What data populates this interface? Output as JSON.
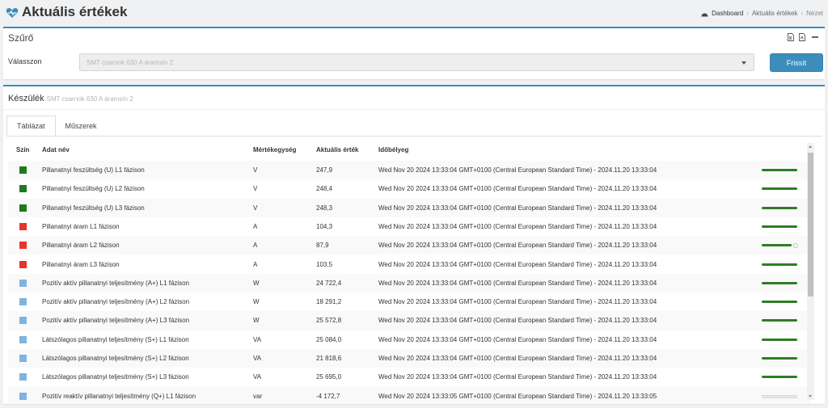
{
  "page": {
    "title": "Aktuális értékek"
  },
  "breadcrumb": {
    "items": [
      "Dashboard",
      "Aktuális értékek",
      "Nézet"
    ]
  },
  "filter": {
    "title": "Szűrő",
    "select_label": "Válasszon",
    "select_value": "SMT csarnok 630 A áramsín 2",
    "button_label": "Frissít"
  },
  "device": {
    "title": "Készülék",
    "subtitle": "SMT csarnok 630 A áramsín 2"
  },
  "tabs": [
    {
      "label": "Táblázat",
      "active": true
    },
    {
      "label": "Műszerek",
      "active": false
    }
  ],
  "table": {
    "headers": {
      "color": "Szín",
      "name": "Adat név",
      "unit": "Mértékegység",
      "value": "Aktuális érték",
      "timestamp": "Időbélyeg"
    },
    "rows": [
      {
        "color": "#1f7a1f",
        "name": "Pillanatnyi feszültség (U) L1 fázison",
        "unit": "V",
        "value": "247,9",
        "timestamp": "Wed Nov 20 2024 13:33:04 GMT+0100 (Central European Standard Time) - 2024.11.20 13:33:04",
        "level": 1.0
      },
      {
        "color": "#1f7a1f",
        "name": "Pillanatnyi feszültség (U) L2 fázison",
        "unit": "V",
        "value": "248,4",
        "timestamp": "Wed Nov 20 2024 13:33:04 GMT+0100 (Central European Standard Time) - 2024.11.20 13:33:04",
        "level": 1.0
      },
      {
        "color": "#1f7a1f",
        "name": "Pillanatnyi feszültség (U) L3 fázison",
        "unit": "V",
        "value": "248,3",
        "timestamp": "Wed Nov 20 2024 13:33:04 GMT+0100 (Central European Standard Time) - 2024.11.20 13:33:04",
        "level": 1.0
      },
      {
        "color": "#e8342a",
        "name": "Pillanatnyi áram L1 fázison",
        "unit": "A",
        "value": "104,3",
        "timestamp": "Wed Nov 20 2024 13:33:04 GMT+0100 (Central European Standard Time) - 2024.11.20 13:33:04",
        "level": 1.0
      },
      {
        "color": "#e8342a",
        "name": "Pillanatnyi áram L2 fázison",
        "unit": "A",
        "value": "87,9",
        "timestamp": "Wed Nov 20 2024 13:33:04 GMT+0100 (Central European Standard Time) - 2024.11.20 13:33:04",
        "level": 0.85
      },
      {
        "color": "#e8342a",
        "name": "Pillanatnyi áram L3 fázison",
        "unit": "A",
        "value": "103,5",
        "timestamp": "Wed Nov 20 2024 13:33:04 GMT+0100 (Central European Standard Time) - 2024.11.20 13:33:04",
        "level": 1.0
      },
      {
        "color": "#7fb3e0",
        "name": "Pozitív aktív pillanatnyi teljesítmény (A+) L1 fázison",
        "unit": "W",
        "value": "24 722,4",
        "timestamp": "Wed Nov 20 2024 13:33:04 GMT+0100 (Central European Standard Time) - 2024.11.20 13:33:04",
        "level": 1.0
      },
      {
        "color": "#7fb3e0",
        "name": "Pozitív aktív pillanatnyi teljesítmény (A+) L2 fázison",
        "unit": "W",
        "value": "18 291,2",
        "timestamp": "Wed Nov 20 2024 13:33:04 GMT+0100 (Central European Standard Time) - 2024.11.20 13:33:04",
        "level": 1.0
      },
      {
        "color": "#7fb3e0",
        "name": "Pozitív aktív pillanatnyi teljesítmény (A+) L3 fázison",
        "unit": "W",
        "value": "25 572,8",
        "timestamp": "Wed Nov 20 2024 13:33:04 GMT+0100 (Central European Standard Time) - 2024.11.20 13:33:04",
        "level": 1.0
      },
      {
        "color": "#7fb3e0",
        "name": "Látszólagos pillanatnyi teljesítmény (S+) L1 fázison",
        "unit": "VA",
        "value": "25 084,0",
        "timestamp": "Wed Nov 20 2024 13:33:04 GMT+0100 (Central European Standard Time) - 2024.11.20 13:33:04",
        "level": 1.0
      },
      {
        "color": "#7fb3e0",
        "name": "Látszólagos pillanatnyi teljesítmény (S+) L2 fázison",
        "unit": "VA",
        "value": "21 818,6",
        "timestamp": "Wed Nov 20 2024 13:33:04 GMT+0100 (Central European Standard Time) - 2024.11.20 13:33:04",
        "level": 1.0
      },
      {
        "color": "#7fb3e0",
        "name": "Látszólagos pillanatnyi teljesítmény (S+) L3 fázison",
        "unit": "VA",
        "value": "25 695,0",
        "timestamp": "Wed Nov 20 2024 13:33:04 GMT+0100 (Central European Standard Time) - 2024.11.20 13:33:04",
        "level": 1.0
      },
      {
        "color": "#7fb3e0",
        "name": "Pozitív reaktív pillanatnyi teljesítmény (Q+) L1 fázison",
        "unit": "var",
        "value": "-4 172,7",
        "timestamp": "Wed Nov 20 2024 13:33:05 GMT+0100 (Central European Standard Time) - 2024.11.20 13:33:05",
        "level": 0.0
      }
    ]
  },
  "colors": {
    "accent": "#3c8dbc",
    "bar_fill": "#2e7d23"
  },
  "icons": {
    "logo": "heart-pulse-icon",
    "home": "dashboard-icon",
    "export_excel": "file-excel-icon",
    "export_pdf": "file-pdf-icon",
    "collapse": "minus-icon"
  }
}
